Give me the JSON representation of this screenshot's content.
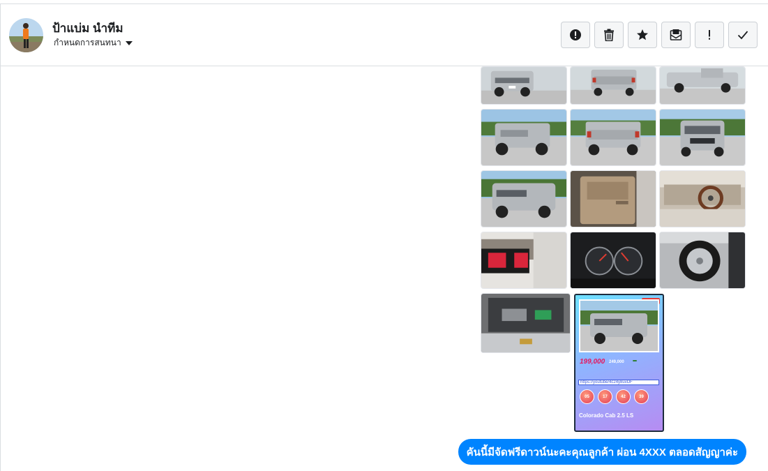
{
  "header": {
    "contact_name": "ป้าแบ่ม นำทีม",
    "subtitle": "กำหนดการสนทนา",
    "actions": [
      {
        "name": "report-button",
        "icon": "exclamation-circle-icon"
      },
      {
        "name": "delete-button",
        "icon": "trash-icon"
      },
      {
        "name": "star-button",
        "icon": "star-icon"
      },
      {
        "name": "mark-unread-button",
        "icon": "envelope-icon"
      },
      {
        "name": "important-button",
        "icon": "exclamation-icon"
      },
      {
        "name": "mark-done-button",
        "icon": "check-icon"
      }
    ]
  },
  "photos": [
    {
      "subject": "front-three-quarter"
    },
    {
      "subject": "rear"
    },
    {
      "subject": "side"
    },
    {
      "subject": "rear-left"
    },
    {
      "subject": "rear-center"
    },
    {
      "subject": "front"
    },
    {
      "subject": "front-left"
    },
    {
      "subject": "door-interior"
    },
    {
      "subject": "dashboard"
    },
    {
      "subject": "seats"
    },
    {
      "subject": "gauges"
    },
    {
      "subject": "wheel"
    },
    {
      "subject": "engine"
    }
  ],
  "featured": {
    "price": "199,000",
    "old_price": "249,000",
    "link_text": "https://youtube/4c24y8uvDF",
    "numbers": [
      "05",
      "17",
      "42",
      "39"
    ],
    "model": "Colorado Cab 2.5 LS"
  },
  "message": {
    "text": "คันนี้มีจัดฟรีดาวน์นะคะคุณลูกค้า ผ่อน 4XXX ตลอดสัญญาค่ะ",
    "color": "#0084ff"
  }
}
